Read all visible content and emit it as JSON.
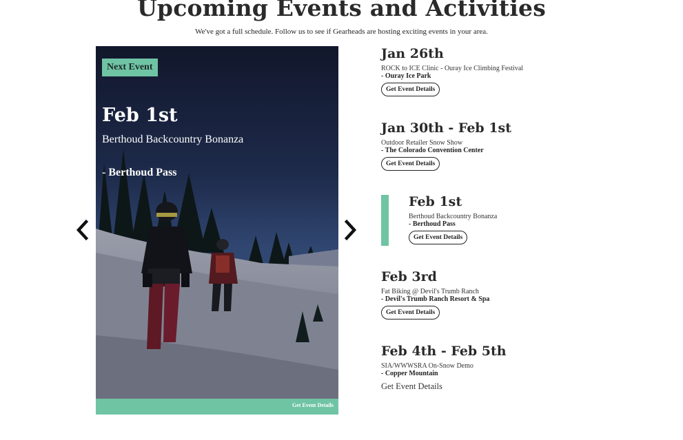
{
  "header": {
    "title": "Upcoming Events and Activities",
    "subtitle": "We've got a full schedule. Follow us to see if Gearheads are hosting exciting events in your area."
  },
  "carousel": {
    "prev_icon": "chevron-left-icon",
    "next_icon": "chevron-right-icon",
    "featured": {
      "badge": "Next Event",
      "date": "Feb 1st",
      "name": "Berthoud Backcountry Bonanza",
      "location": "- Berthoud Pass",
      "footer_link": "Get Event Details"
    }
  },
  "events": [
    {
      "date": "Jan 26th",
      "name": "ROCK to ICE Clinic - Ouray Ice Climbing Festival",
      "location": "- Ouray Ice Park",
      "button": "Get Event Details"
    },
    {
      "date": "Jan 30th - Feb 1st",
      "name": "Outdoor Retailer Snow Show",
      "location": "- The Colorado Convention Center",
      "button": "Get Event Details"
    },
    {
      "date": "Feb 1st",
      "name": "Berthoud Backcountry Bonanza",
      "location": "- Berthoud Pass",
      "button": "Get Event Details"
    },
    {
      "date": "Feb 3rd",
      "name": "Fat Biking @ Devil's Trumb Ranch",
      "location": "- Devil's Trumb Ranch Resort & Spa",
      "button": "Get Event Details"
    },
    {
      "date": "Feb 4th - Feb 5th",
      "name": "SIA/WWWSRA On-Snow Demo",
      "location": "- Copper Mountain",
      "button": "Get Event Details"
    }
  ],
  "colors": {
    "accent": "#6fc4a4",
    "text": "#222222",
    "overlay": "#1b2238"
  }
}
